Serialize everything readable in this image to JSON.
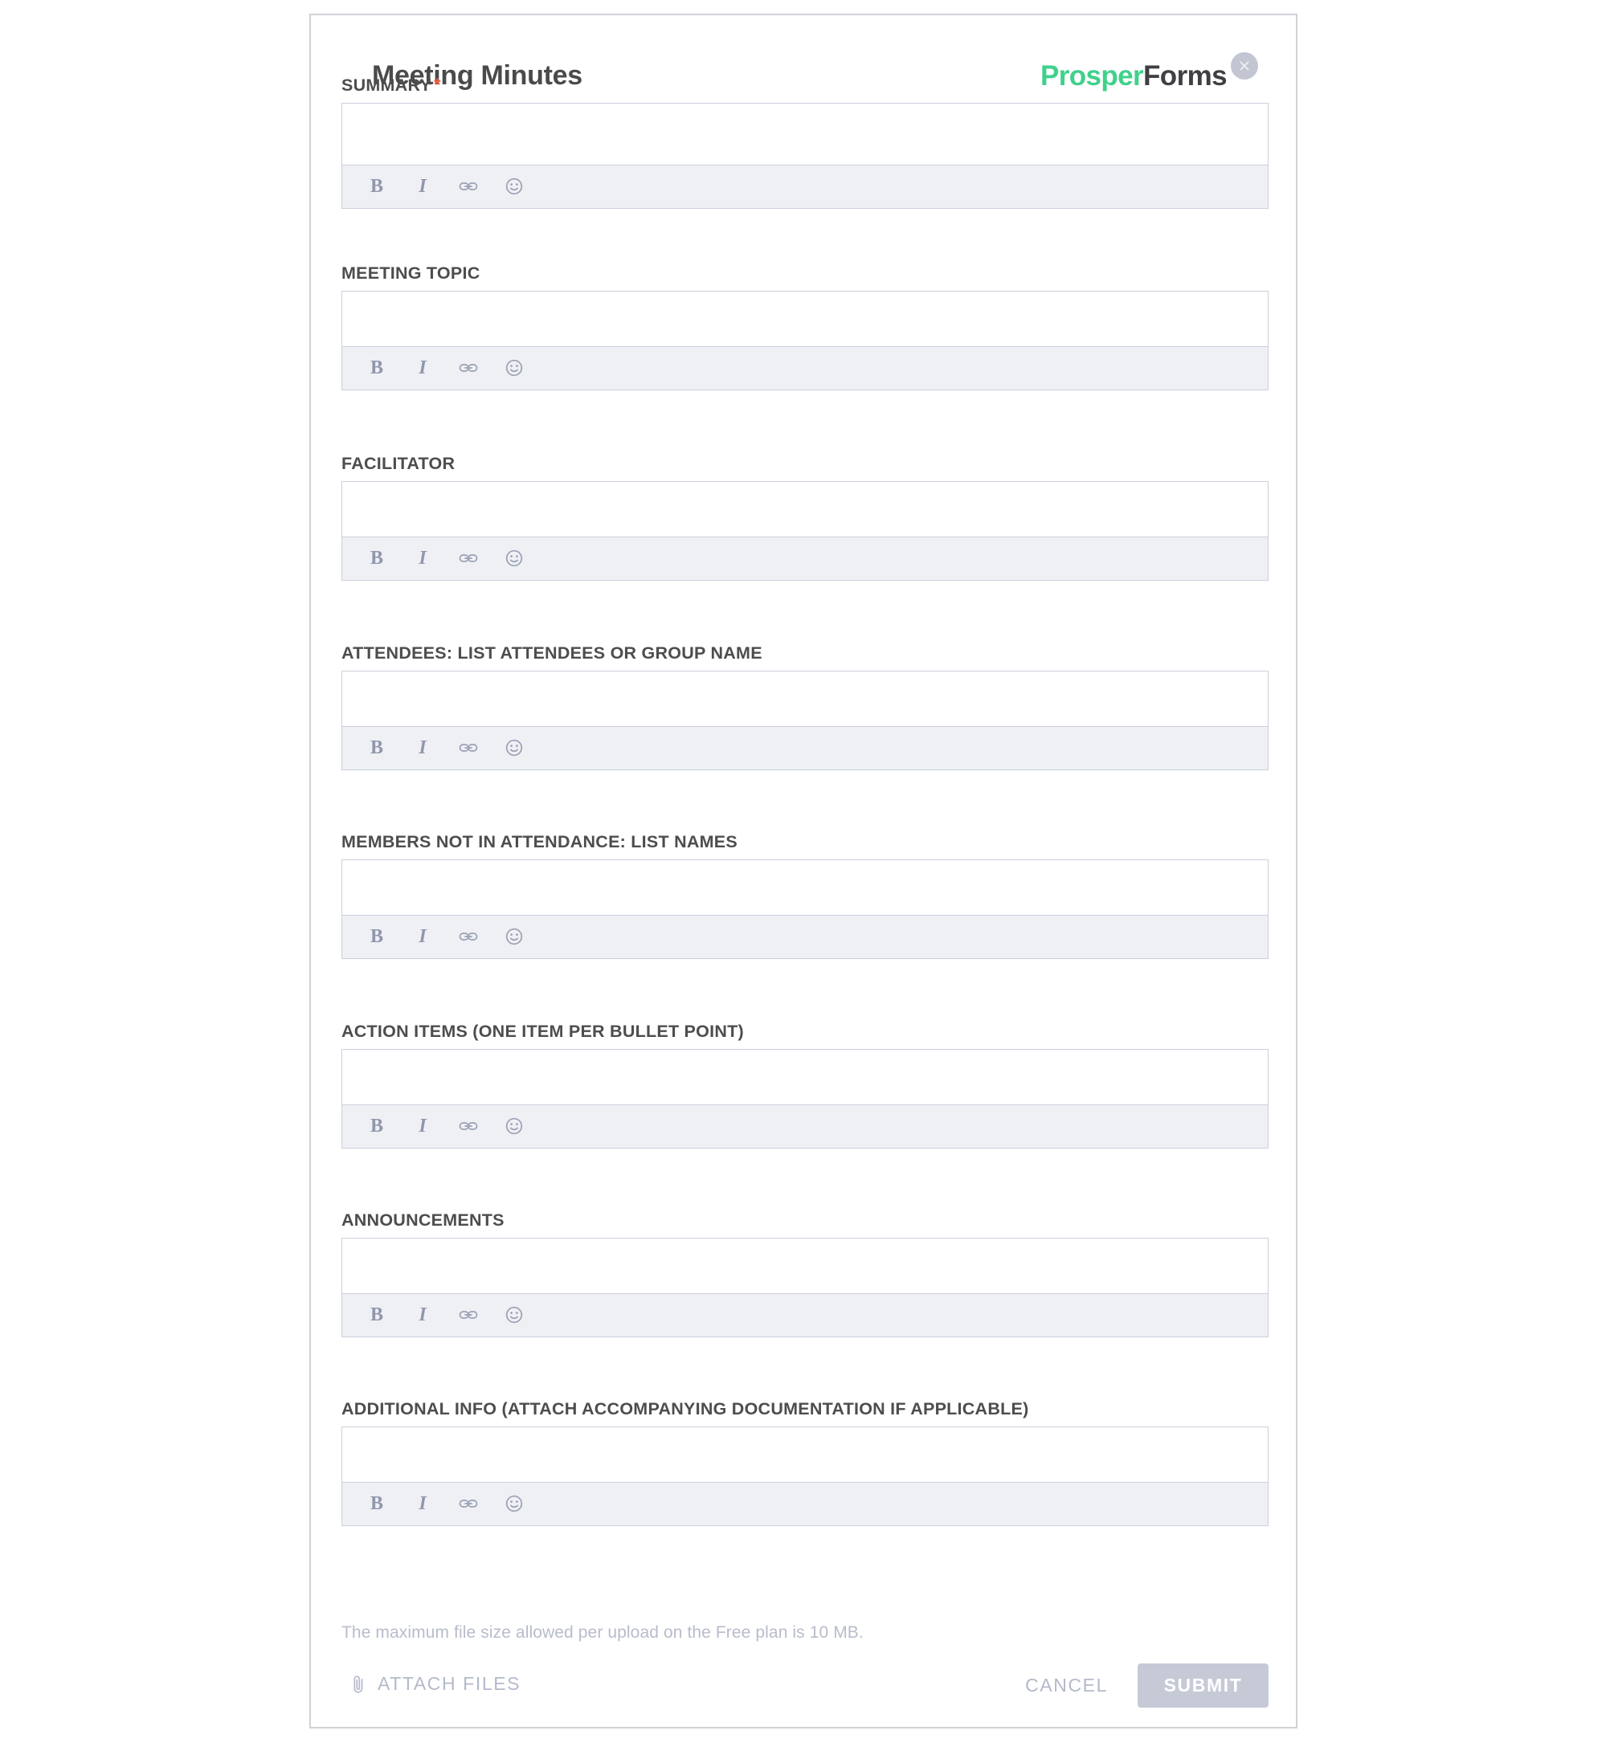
{
  "header": {
    "title": "Meeting Minutes",
    "brand_prosper": "Prosper",
    "brand_forms": "Forms",
    "close_icon": "close-icon"
  },
  "colors": {
    "brand_green": "#3fd18b",
    "brand_dark": "#3f3f44",
    "required_star": "#f4603e",
    "label_text": "#4d4d4d",
    "muted_text": "#b4b9cb",
    "toolbar_bg": "#eef0f4",
    "input_border": "#ccd0dc",
    "submit_bg": "#c6cad7",
    "panel_border": "#cfd2d6"
  },
  "toolbar": {
    "buttons": [
      {
        "name": "bold",
        "glyph": "B",
        "title": "Bold"
      },
      {
        "name": "italic",
        "glyph": "I",
        "title": "Italic"
      },
      {
        "name": "link",
        "glyph": "link-icon",
        "title": "Link"
      },
      {
        "name": "emoji",
        "glyph": "smiley-icon",
        "title": "Emoji"
      }
    ]
  },
  "fields": [
    {
      "label": "SUMMARY",
      "required": true,
      "value": "",
      "placeholder": ""
    },
    {
      "label": "MEETING TOPIC",
      "required": false,
      "value": "",
      "placeholder": ""
    },
    {
      "label": "FACILITATOR",
      "required": false,
      "value": "",
      "placeholder": ""
    },
    {
      "label": "ATTENDEES: LIST ATTENDEES OR GROUP NAME",
      "required": false,
      "value": "",
      "placeholder": ""
    },
    {
      "label": "MEMBERS NOT IN ATTENDANCE: LIST NAMES",
      "required": false,
      "value": "",
      "placeholder": ""
    },
    {
      "label": "ACTION ITEMS (ONE ITEM PER BULLET POINT)",
      "required": false,
      "value": "",
      "placeholder": ""
    },
    {
      "label": "ANNOUNCEMENTS",
      "required": false,
      "value": "",
      "placeholder": ""
    },
    {
      "label": "ADDITIONAL INFO (ATTACH ACCOMPANYING DOCUMENTATION IF APPLICABLE)",
      "required": false,
      "value": "",
      "placeholder": ""
    }
  ],
  "footer": {
    "note": "The maximum file size allowed per upload on the Free plan is 10 MB.",
    "attach_label": "ATTACH FILES",
    "attach_icon": "paperclip-icon",
    "cancel_label": "CANCEL",
    "submit_label": "SUBMIT"
  }
}
